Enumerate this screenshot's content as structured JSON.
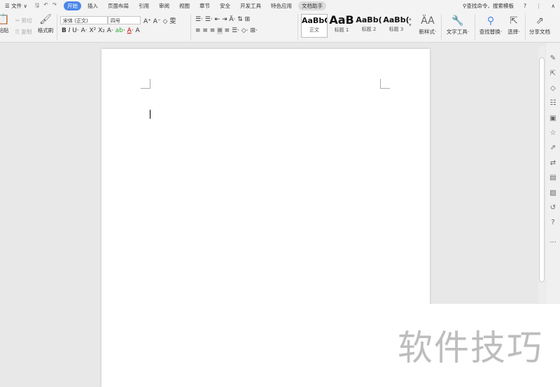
{
  "menubar": {
    "file": "文件",
    "tabs": [
      "开始",
      "插入",
      "页面布局",
      "引用",
      "审阅",
      "视图",
      "章节",
      "安全",
      "开发工具",
      "特色应用",
      "文档助手"
    ],
    "active_tab": "开始",
    "search": "查找命令、搜索模板",
    "help": "?"
  },
  "ribbon": {
    "paste": "粘贴",
    "cut": "剪切",
    "copy": "复制",
    "format_painter": "格式刷",
    "font_name": "宋体 (正文)",
    "font_size": "四号",
    "styles": [
      {
        "sample": "AaBbC",
        "label": "正文"
      },
      {
        "sample": "AaB",
        "label": "标题 1"
      },
      {
        "sample": "AaBb(",
        "label": "标题 2"
      },
      {
        "sample": "AaBb(",
        "label": "标题 3"
      }
    ],
    "new_style": "新样式",
    "text_tools": "文字工具",
    "find_replace": "查找替换",
    "select": "选择",
    "share": "分享文档"
  },
  "watermark": "软件技巧"
}
